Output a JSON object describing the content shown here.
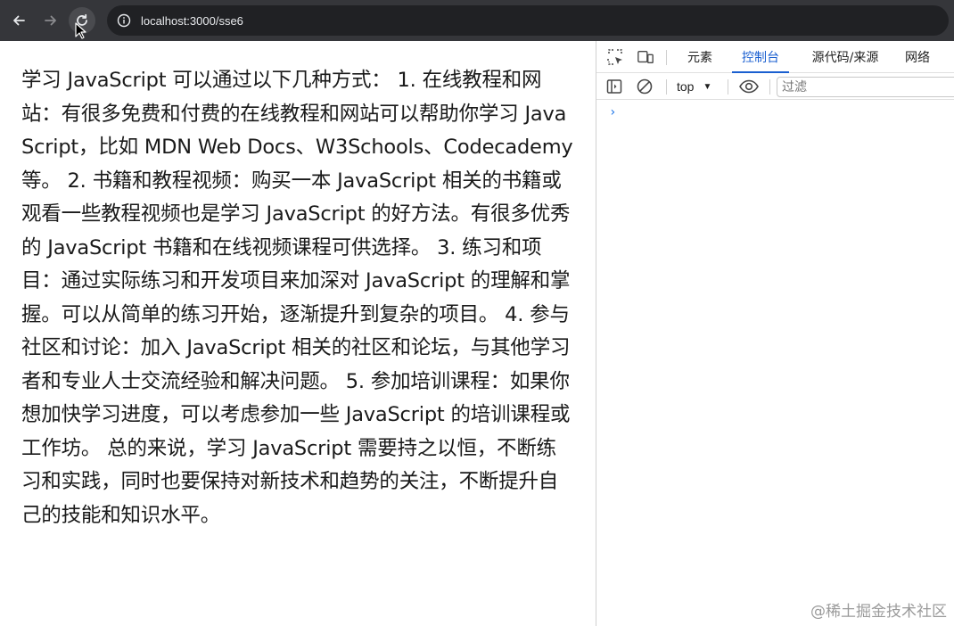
{
  "browser": {
    "url": "localhost:3000/sse6",
    "icons": {
      "back": "arrow-left-icon",
      "forward": "arrow-right-icon",
      "reload": "reload-icon",
      "info": "info-icon"
    }
  },
  "page": {
    "article_text": "学习 JavaScript 可以通过以下几种方式： 1. 在线教程和网站：有很多免费和付费的在线教程和网站可以帮助你学习 JavaScript，比如 MDN Web Docs、W3Schools、Codecademy 等。 2. 书籍和教程视频：购买一本 JavaScript 相关的书籍或观看一些教程视频也是学习 JavaScript 的好方法。有很多优秀的 JavaScript 书籍和在线视频课程可供选择。 3. 练习和项目：通过实际练习和开发项目来加深对 JavaScript 的理解和掌握。可以从简单的练习开始，逐渐提升到复杂的项目。 4. 参与社区和讨论：加入 JavaScript 相关的社区和论坛，与其他学习者和专业人士交流经验和解决问题。 5. 参加培训课程：如果你想加快学习进度，可以考虑参加一些 JavaScript 的培训课程或工作坊。 总的来说，学习 JavaScript 需要持之以恒，不断练习和实践，同时也要保持对新技术和趋势的关注，不断提升自己的技能和知识水平。"
  },
  "devtools": {
    "tabs": [
      {
        "label": "元素",
        "active": false
      },
      {
        "label": "控制台",
        "active": true
      },
      {
        "label": "源代码/来源",
        "active": false
      },
      {
        "label": "网络",
        "active": false
      }
    ],
    "context": "top",
    "filter_placeholder": "过滤",
    "prompt_symbol": "›",
    "icons": {
      "inspect": "inspect-element-icon",
      "device": "device-toolbar-icon",
      "sidebar": "sidebar-toggle-icon",
      "clear": "clear-console-icon",
      "eye": "live-expression-eye-icon"
    },
    "accent_color": "#1a5fd0"
  },
  "watermark": "@稀土掘金技术社区"
}
